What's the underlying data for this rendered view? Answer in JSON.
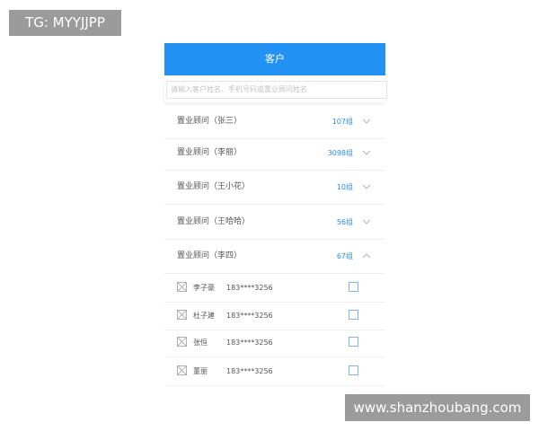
{
  "watermarks": {
    "top": "TG: MYYJJPP",
    "bottom": "www.shanzhoubang.com"
  },
  "header": {
    "title": "客户"
  },
  "search": {
    "placeholder": "请输入客户姓名、手机号码或置业顾问姓名"
  },
  "groups": [
    {
      "label": "置业顾问（张三）",
      "count": "107组",
      "expanded": false
    },
    {
      "label": "置业顾问（李丽）",
      "count": "3098组",
      "expanded": false
    },
    {
      "label": "置业顾问（王小花）",
      "count": "10组",
      "expanded": false
    },
    {
      "label": "置业顾问（王哈哈）",
      "count": "56组",
      "expanded": false
    },
    {
      "label": "置业顾问（李四）",
      "count": "67组",
      "expanded": true
    }
  ],
  "members": [
    {
      "name": "李子豪",
      "phone": "183****3256"
    },
    {
      "name": "杜子建",
      "phone": "183****3256"
    },
    {
      "name": "张恒",
      "phone": "183****3256"
    },
    {
      "name": "董丽",
      "phone": "183****3256"
    }
  ],
  "colors": {
    "accent": "#2192f3",
    "count_text": "#2b8ee6",
    "checkbox_border": "#7fb6ee"
  },
  "icons": {
    "collapsed": "chevron-down-icon",
    "expanded": "chevron-up-icon",
    "avatar": "broken-image-icon"
  }
}
